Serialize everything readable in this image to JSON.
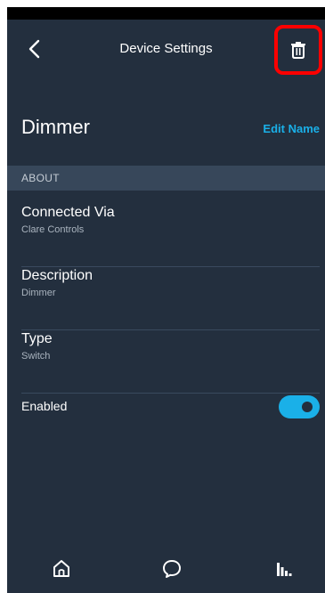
{
  "header": {
    "title": "Device Settings",
    "back_icon": "chevron-left-icon",
    "delete_icon": "trash-icon"
  },
  "device": {
    "name": "Dimmer",
    "edit_label": "Edit Name"
  },
  "section": {
    "title": "ABOUT"
  },
  "rows": [
    {
      "label": "Connected Via",
      "value": "Clare Controls"
    },
    {
      "label": "Description",
      "value": "Dimmer"
    },
    {
      "label": "Type",
      "value": "Switch"
    }
  ],
  "enabled": {
    "label": "Enabled",
    "value": true
  },
  "nav": {
    "items": [
      "home-icon",
      "chat-icon",
      "play-icon"
    ]
  },
  "colors": {
    "background": "#232f3e",
    "section": "#37475a",
    "accent": "#1ab0e8",
    "highlight": "#ff0000"
  }
}
